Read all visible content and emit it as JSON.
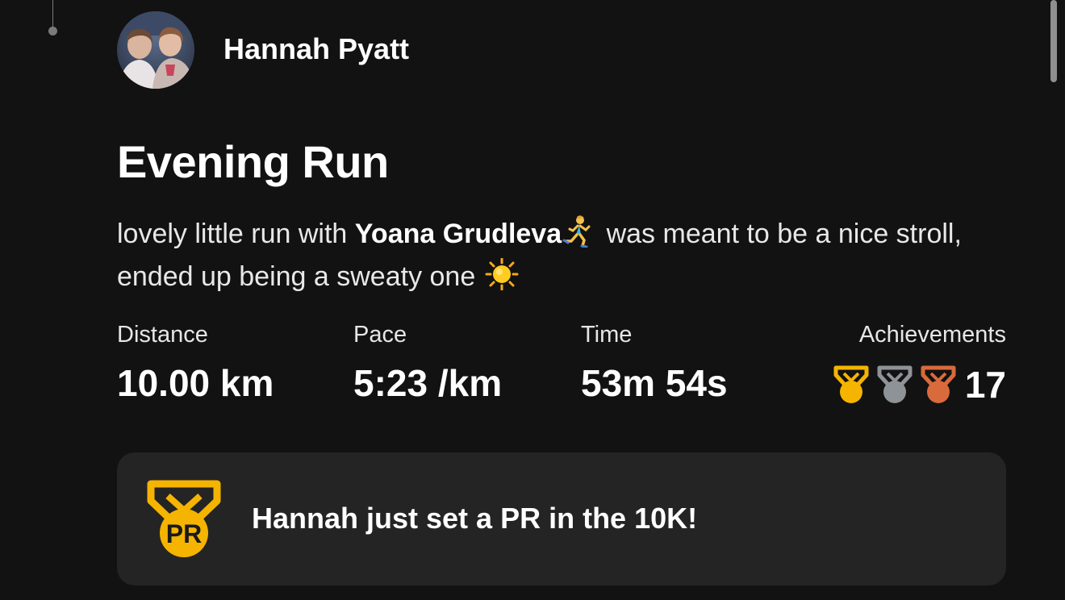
{
  "athlete": {
    "name": "Hannah Pyatt"
  },
  "activity": {
    "title": "Evening Run",
    "description": {
      "part1": "lovely little run with ",
      "tagged_athlete": "Yoana Grudleva",
      "part2": " was meant to be a nice stroll, ended up being a sweaty one ",
      "emoji_1": "woman-running-emoji",
      "emoji_2": "sun-emoji"
    }
  },
  "stats": {
    "distance": {
      "label": "Distance",
      "value": "10.00 km"
    },
    "pace": {
      "label": "Pace",
      "value": "5:23 /km"
    },
    "time": {
      "label": "Time",
      "value": "53m 54s"
    },
    "achievements": {
      "label": "Achievements",
      "count": "17",
      "icons": [
        "gold-medal-icon",
        "silver-medal-icon",
        "bronze-medal-icon"
      ]
    }
  },
  "pr_banner": {
    "badge_text": "PR",
    "message": "Hannah just set a PR in the 10K!"
  },
  "colors": {
    "background": "#121212",
    "card": "#242424",
    "gold": "#f5b400",
    "silver": "#8d9396",
    "bronze": "#d86a3c"
  }
}
